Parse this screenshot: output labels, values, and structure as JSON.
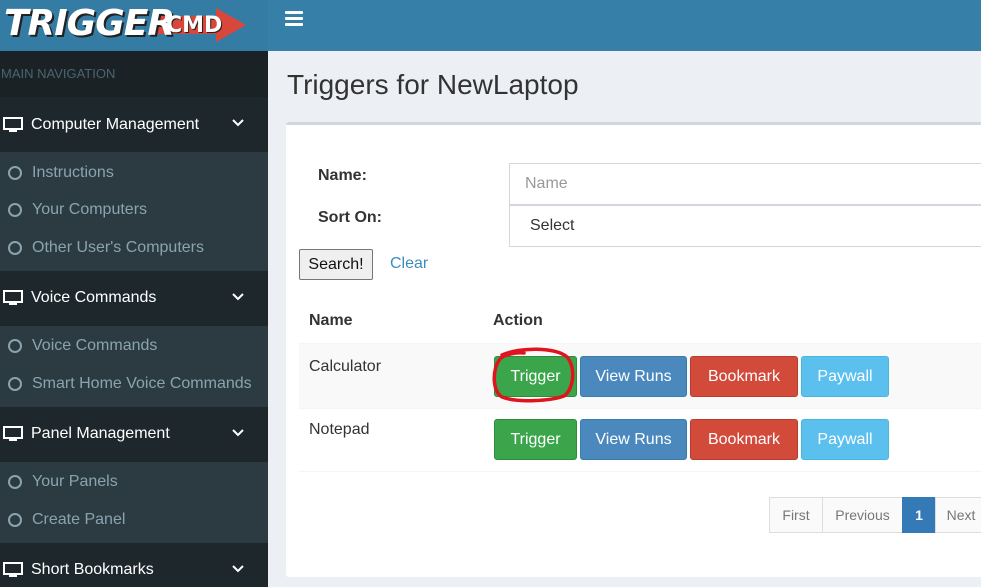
{
  "brand": {
    "word1": "TRIGGER",
    "word2": "CMD",
    "arrow_color": "#d9473a"
  },
  "sidebar": {
    "header": "MAIN NAVIGATION",
    "sections": [
      {
        "label": "Computer Management",
        "items": [
          "Instructions",
          "Your Computers",
          "Other User's Computers"
        ]
      },
      {
        "label": "Voice Commands",
        "items": [
          "Voice Commands",
          "Smart Home Voice Commands"
        ]
      },
      {
        "label": "Panel Management",
        "items": [
          "Your Panels",
          "Create Panel"
        ]
      },
      {
        "label": "Short Bookmarks",
        "items": []
      }
    ]
  },
  "page": {
    "title": "Triggers for NewLaptop"
  },
  "search_form": {
    "name_label": "Name:",
    "name_placeholder": "Name",
    "sort_label": "Sort On:",
    "sort_value": "Select",
    "search_button": "Search!",
    "clear_link": "Clear"
  },
  "table": {
    "headers": [
      "Name",
      "Action"
    ],
    "rows": [
      {
        "name": "Calculator",
        "actions": [
          "Trigger",
          "View Runs",
          "Bookmark",
          "Paywall"
        ]
      },
      {
        "name": "Notepad",
        "actions": [
          "Trigger",
          "View Runs",
          "Bookmark",
          "Paywall"
        ]
      }
    ]
  },
  "pagination": {
    "first": "First",
    "previous": "Previous",
    "current": "1",
    "next": "Next"
  },
  "colors": {
    "header": "#367fa9",
    "sidebar": "#222d32",
    "trigger": "#3aa54b",
    "view_runs": "#4b88bd",
    "bookmark": "#d24a3a",
    "paywall": "#5bc0ee",
    "annotation": "#e0141e"
  }
}
